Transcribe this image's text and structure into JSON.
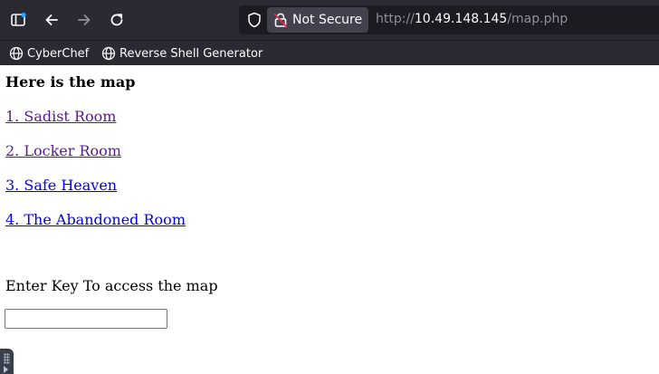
{
  "browser": {
    "security_label": "Not Secure",
    "url": {
      "protocol": "http://",
      "host": "10.49.148.145",
      "path": "/map.php"
    },
    "icons": {
      "sidebar": "sidebar-icon",
      "back": "back-arrow-icon",
      "forward": "forward-arrow-icon",
      "reload": "reload-icon",
      "shield": "shield-icon",
      "lock": "lock-icon"
    },
    "bookmarks": [
      {
        "label": "CyberChef",
        "icon": "globe-icon"
      },
      {
        "label": "Reverse Shell Generator",
        "icon": "globe-icon"
      }
    ],
    "colors": {
      "chrome_bg": "#2b2a33",
      "urlbar_bg": "#1c1b22",
      "chip_bg": "#42414d",
      "text": "#fbfbfe",
      "dim_text": "#8f8f9d",
      "insecure_lock": "#e22850"
    }
  },
  "page": {
    "heading": "Here is the map",
    "links": [
      {
        "label": "1. Sadist Room",
        "visited": true
      },
      {
        "label": "2. Locker Room",
        "visited": true
      },
      {
        "label": "3. Safe Heaven",
        "visited": false
      },
      {
        "label": "4. The Abandoned Room",
        "visited": false
      }
    ],
    "key_prompt": "Enter Key To access the map",
    "key_input_value": "",
    "colors": {
      "visited_link": "#551a8b",
      "unvisited_link": "#0000ee"
    }
  }
}
